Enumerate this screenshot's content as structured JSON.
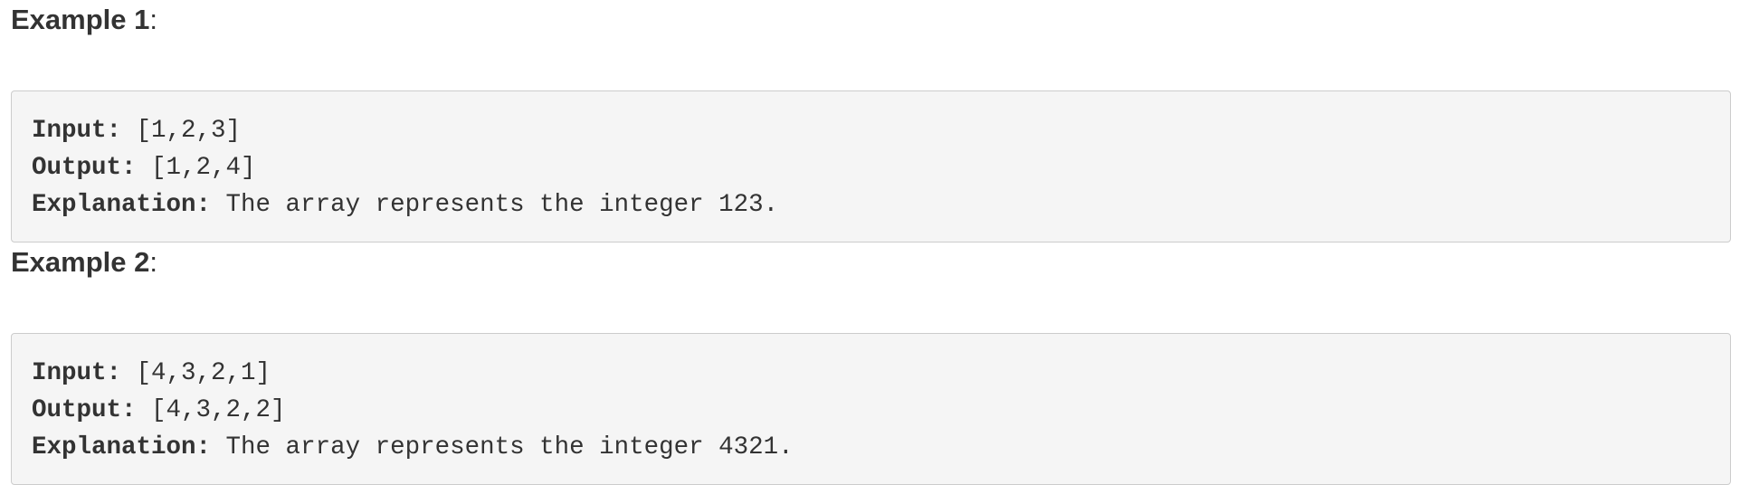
{
  "examples": [
    {
      "heading": "Example 1",
      "heading_colon": ":",
      "input_label": "Input:",
      "input_value": " [1,2,3]",
      "output_label": "Output:",
      "output_value": " [1,2,4]",
      "explanation_label": "Explanation:",
      "explanation_value": " The array represents the integer 123."
    },
    {
      "heading": "Example 2",
      "heading_colon": ":",
      "input_label": "Input:",
      "input_value": " [4,3,2,1]",
      "output_label": "Output:",
      "output_value": " [4,3,2,2]",
      "explanation_label": "Explanation:",
      "explanation_value": " The array represents the integer 4321."
    }
  ]
}
